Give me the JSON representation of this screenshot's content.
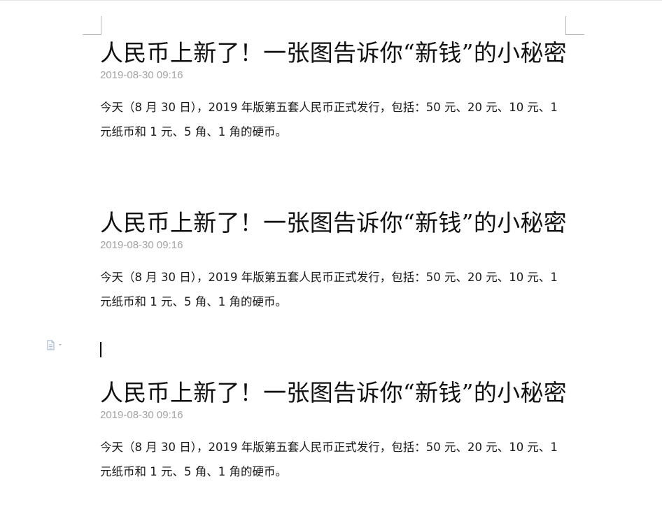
{
  "articles": [
    {
      "title": "人民币上新了！一张图告诉你“新钱”的小秘密",
      "date": "2019-08-30 09:16",
      "body": "今天（8 月 30 日），2019 年版第五套人民币正式发行，包括：50 元、20 元、10 元、1 元纸币和 1 元、5 角、1 角的硬币。"
    },
    {
      "title": "人民币上新了！一张图告诉你“新钱”的小秘密",
      "date": "2019-08-30 09:16",
      "body": "今天（8 月 30 日），2019 年版第五套人民币正式发行，包括：50 元、20 元、10 元、1 元纸币和 1 元、5 角、1 角的硬币。"
    },
    {
      "title": "人民币上新了！一张图告诉你“新钱”的小秘密",
      "date": "2019-08-30 09:16",
      "body": "今天（8 月 30 日），2019 年版第五套人民币正式发行，包括：50 元、20 元、10 元、1 元纸币和 1 元、5 角、1 角的硬币。"
    }
  ],
  "icons": {
    "paragraph_menu": "document-icon",
    "paragraph_menu_arrow": "chevron-down-icon"
  },
  "colors": {
    "date_text": "#a3a3a3",
    "margin_marks": "#b9b9b9",
    "paragraph_icon": "#a9b9d1"
  }
}
